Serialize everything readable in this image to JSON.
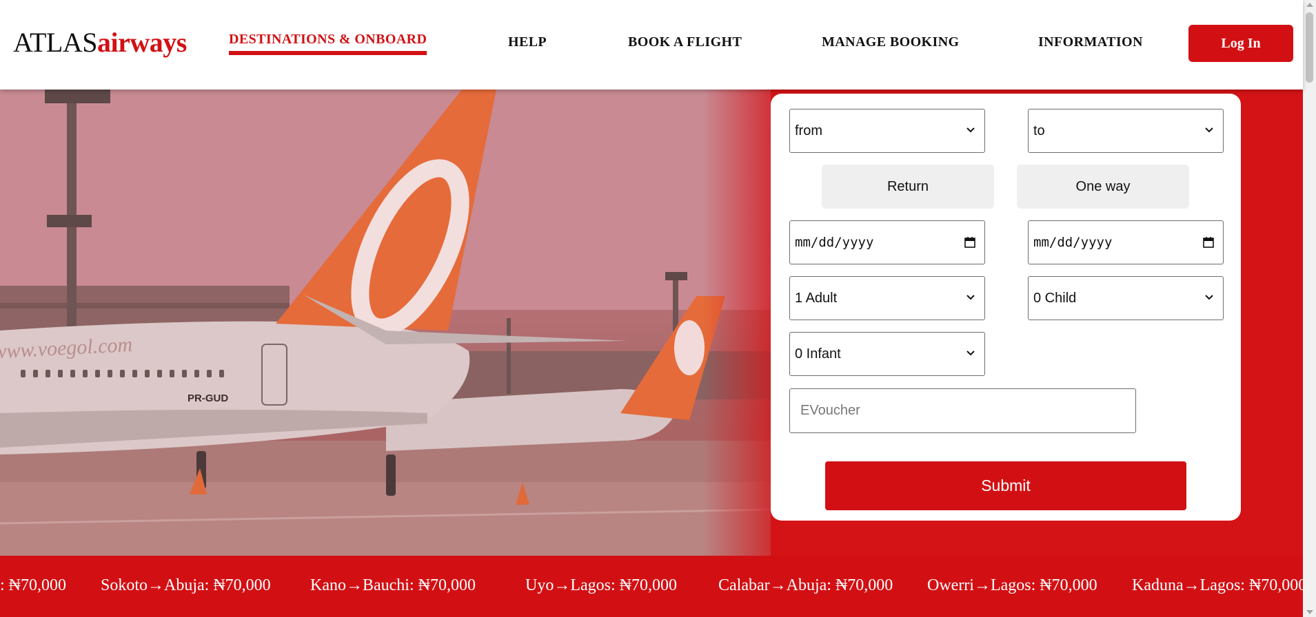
{
  "header": {
    "logo_light": "ATLAS",
    "logo_bold": "airways",
    "nav": [
      {
        "label": "DESTINATIONS & ONBOARD",
        "active": true
      },
      {
        "label": "HELP"
      },
      {
        "label": "BOOK A FLIGHT"
      },
      {
        "label": "MANAGE BOOKING"
      },
      {
        "label": "INFORMATION"
      }
    ],
    "login_label": "Log In"
  },
  "hero": {
    "image": "airport-apron-with-orange-tailed-aircraft",
    "aircraft_website_text": "www.voegol.com",
    "aircraft_registration": "PR-GUD"
  },
  "booking": {
    "from_value": "from",
    "to_value": "to",
    "return_label": "Return",
    "one_way_label": "One way",
    "depart_date_placeholder": "mm/dd/yyyy",
    "return_date_placeholder": "mm/dd/yyyy",
    "adults_value": "1 Adult",
    "children_value": "0 Child",
    "infants_value": "0 Infant",
    "evoucher_placeholder": "EVoucher",
    "submit_label": "Submit"
  },
  "ticker": [
    ": ₦70,000",
    "Sokoto→Abuja: ₦70,000",
    "Kano→Bauchi: ₦70,000",
    "Uyo→Lagos: ₦70,000",
    "Calabar→Abuja: ₦70,000",
    "Owerri→Lagos: ₦70,000",
    "Kaduna→Lagos: ₦70,000"
  ],
  "colors": {
    "brand_red": "#d21014",
    "text_dark": "#111111",
    "button_gray": "#efefef"
  }
}
